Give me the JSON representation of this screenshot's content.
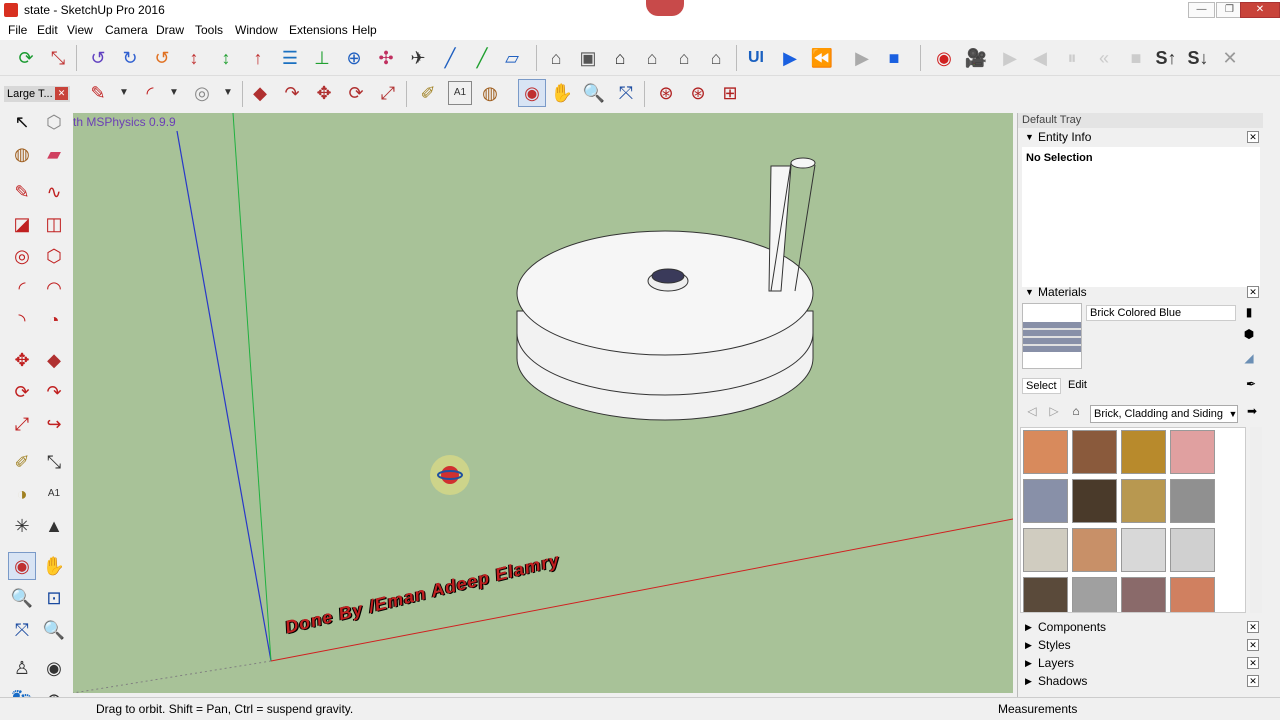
{
  "window": {
    "title": "state - SketchUp Pro 2016",
    "minimize": "—",
    "maximize": "❐",
    "close": "✕"
  },
  "menu": [
    "File",
    "Edit",
    "View",
    "Camera",
    "Draw",
    "Tools",
    "Window",
    "Extensions",
    "Help"
  ],
  "large_toolset": {
    "title": "Large T...",
    "close": "✕"
  },
  "viewport": {
    "plugin_label": "th MSPhysics 0.9.9",
    "watermark": "Done By /Eman Adeep   Elamry"
  },
  "status": {
    "hint": "Drag to orbit. Shift = Pan, Ctrl = suspend gravity.",
    "measurements_label": "Measurements"
  },
  "tray": {
    "title": "Default Tray",
    "entity_info": {
      "label": "Entity Info",
      "selection": "No Selection"
    },
    "materials": {
      "label": "Materials",
      "current_name": "Brick Colored Blue",
      "tabs": [
        "Select",
        "Edit"
      ],
      "collection": "Brick, Cladding and Siding",
      "swatches": [
        "#d88a5c",
        "#8a5a3c",
        "#b88a2c",
        "#e0a0a0",
        "#8890a8",
        "#4a3a2a",
        "#b89850",
        "#909090",
        "#d0ccc0",
        "#c89068",
        "#d8d8d8",
        "#d0d0d0",
        "#5a4a3a",
        "#a0a0a0",
        "#8a6a6a",
        "#d08060"
      ]
    },
    "collapsed_panels": [
      "Components",
      "Styles",
      "Layers",
      "Shadows"
    ]
  }
}
